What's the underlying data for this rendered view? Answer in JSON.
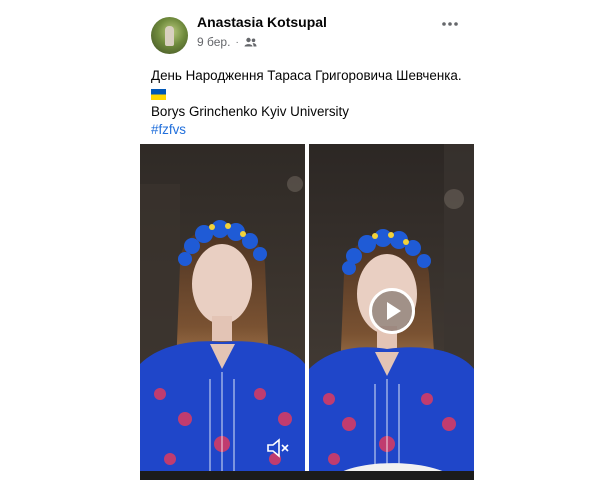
{
  "post": {
    "author": "Anastasia Kotsupal",
    "date": "9 бер.",
    "separator": "·",
    "audience_icon": "friends-icon",
    "more_icon": "more-horizontal-icon",
    "text_line_1": "День Народження Тараса Григоровича Шевченка.",
    "flag_icon": "ukraine-flag-icon",
    "text_line_3": "Borys Grinchenko Kyiv University",
    "hashtag": "#fzfvs"
  },
  "media": {
    "videos": [
      {
        "name": "video-left",
        "controls": "mute-icon"
      },
      {
        "name": "video-right",
        "controls": "play-icon"
      }
    ]
  },
  "colors": {
    "text": "#050505",
    "meta": "#65676b",
    "link": "#216fdb",
    "flag_blue": "#0057b7",
    "flag_yellow": "#ffd700",
    "embroidery_blue": "#1f46c9"
  }
}
